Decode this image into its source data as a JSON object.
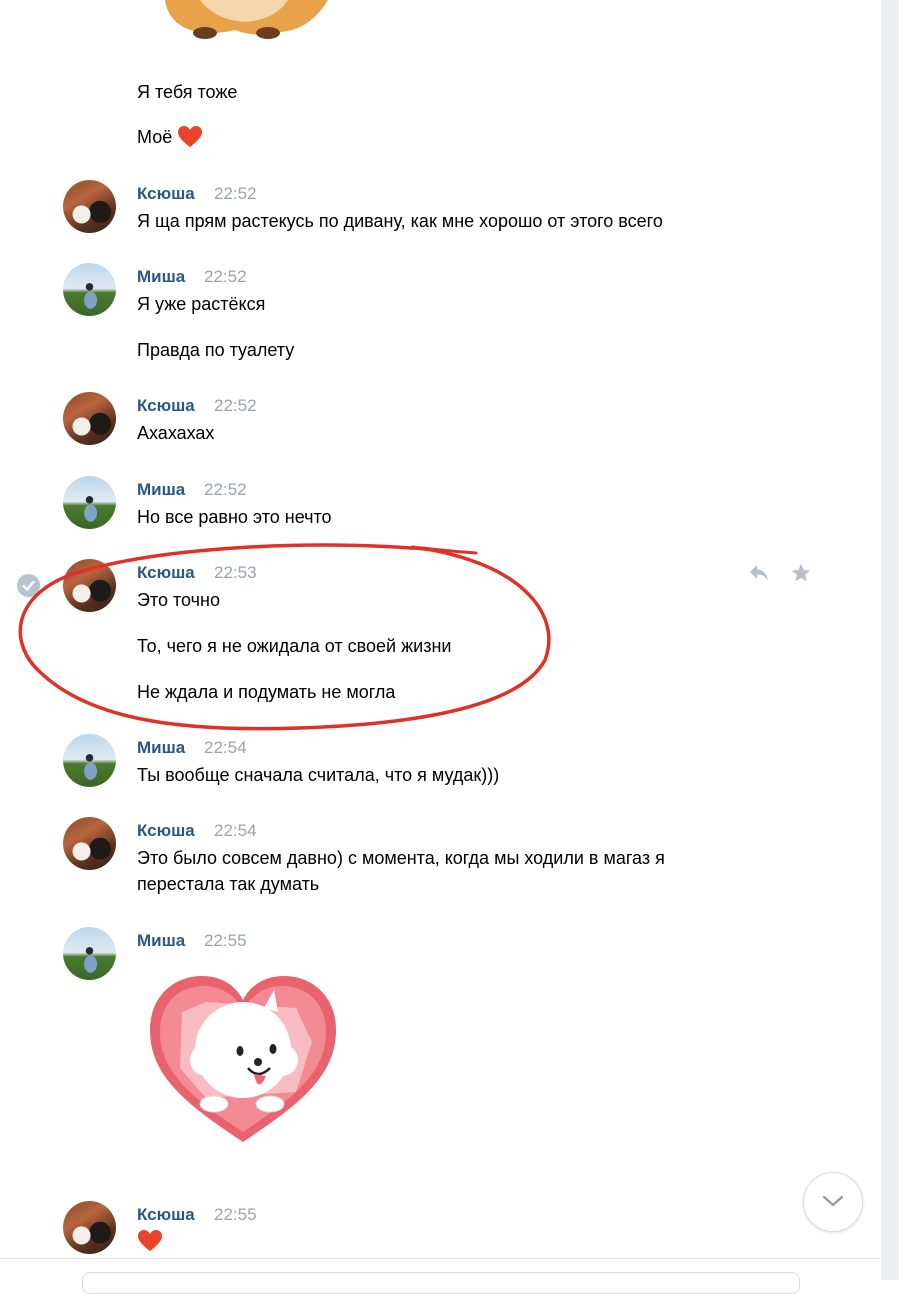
{
  "messages": {
    "top_text_1": "Я тебя тоже",
    "top_text_2": "Моё",
    "m1": {
      "author": "Ксюша",
      "time": "22:52",
      "lines": [
        "Я ща прям растекусь по дивану, как мне хорошо от этого всего"
      ]
    },
    "m2": {
      "author": "Миша",
      "time": "22:52",
      "lines": [
        "Я уже растёкся",
        "Правда по туалету"
      ]
    },
    "m3": {
      "author": "Ксюша",
      "time": "22:52",
      "lines": [
        "Ахахахах"
      ]
    },
    "m4": {
      "author": "Миша",
      "time": "22:52",
      "lines": [
        "Но все равно это нечто"
      ]
    },
    "m5": {
      "author": "Ксюша",
      "time": "22:53",
      "lines": [
        "Это точно",
        "То, чего я не ожидала от своей жизни",
        "Не ждала и подумать не могла"
      ]
    },
    "m6": {
      "author": "Миша",
      "time": "22:54",
      "lines": [
        "Ты вообще сначала считала, что я мудак)))"
      ]
    },
    "m7": {
      "author": "Ксюша",
      "time": "22:54",
      "lines": [
        "Это было совсем давно) с момента, когда мы ходили в магаз я",
        "перестала так думать"
      ]
    },
    "m8": {
      "author": "Миша",
      "time": "22:55",
      "sticker": "white-dog-in-heart-sticker"
    },
    "m9": {
      "author": "Ксюша",
      "time": "22:55",
      "emoji": "heart-icon"
    }
  },
  "icons": {
    "reply": "reply-icon",
    "favorite": "star-icon",
    "selected": "check-circle-icon",
    "scroll_down": "chevron-down-icon"
  },
  "colors": {
    "author_name": "#2a5885",
    "timestamp": "#9aa3ad",
    "highlight_circle": "#e03127",
    "heart": "#e8452c"
  }
}
